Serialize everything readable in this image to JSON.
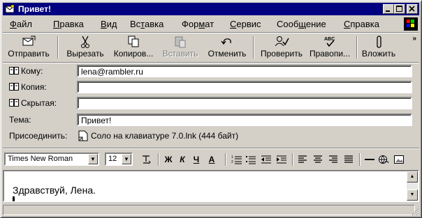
{
  "window": {
    "title": "Привет!"
  },
  "menu": {
    "items": [
      {
        "u": "Ф",
        "rest": "айл"
      },
      {
        "u": "П",
        "rest": "равка"
      },
      {
        "u": "В",
        "rest": "ид"
      },
      {
        "pre": "Вс",
        "u": "т",
        "rest": "авка"
      },
      {
        "pre": "Фор",
        "u": "м",
        "rest": "ат"
      },
      {
        "u": "С",
        "rest": "ервис"
      },
      {
        "pre": "Сооб",
        "u": "щ",
        "rest": "ение"
      },
      {
        "u": "С",
        "rest": "правка"
      }
    ]
  },
  "toolbar": {
    "send": "Отправить",
    "cut": "Вырезать",
    "copy": "Копиров...",
    "paste": "Вставить",
    "undo": "Отменить",
    "check": "Проверить",
    "spell": "Правопи...",
    "attach": "Вложить"
  },
  "fields": {
    "to_label": "Кому:",
    "to_value": "lena@rambler.ru",
    "cc_label": "Копия:",
    "cc_value": "",
    "bcc_label": "Скрытая:",
    "bcc_value": "",
    "subject_label": "Тема:",
    "subject_value": "Привет!",
    "attach_label": "Присоединить:",
    "attach_value": "Соло на клавиатуре 7.0.lnk (444 байт)"
  },
  "format": {
    "font": "Times New Roman",
    "size": "12",
    "bold": "Ж",
    "italic": "К",
    "underline": "Ч",
    "color": "А"
  },
  "body": {
    "text": "Здравствуй, Лена."
  },
  "status": {
    "text": ""
  }
}
